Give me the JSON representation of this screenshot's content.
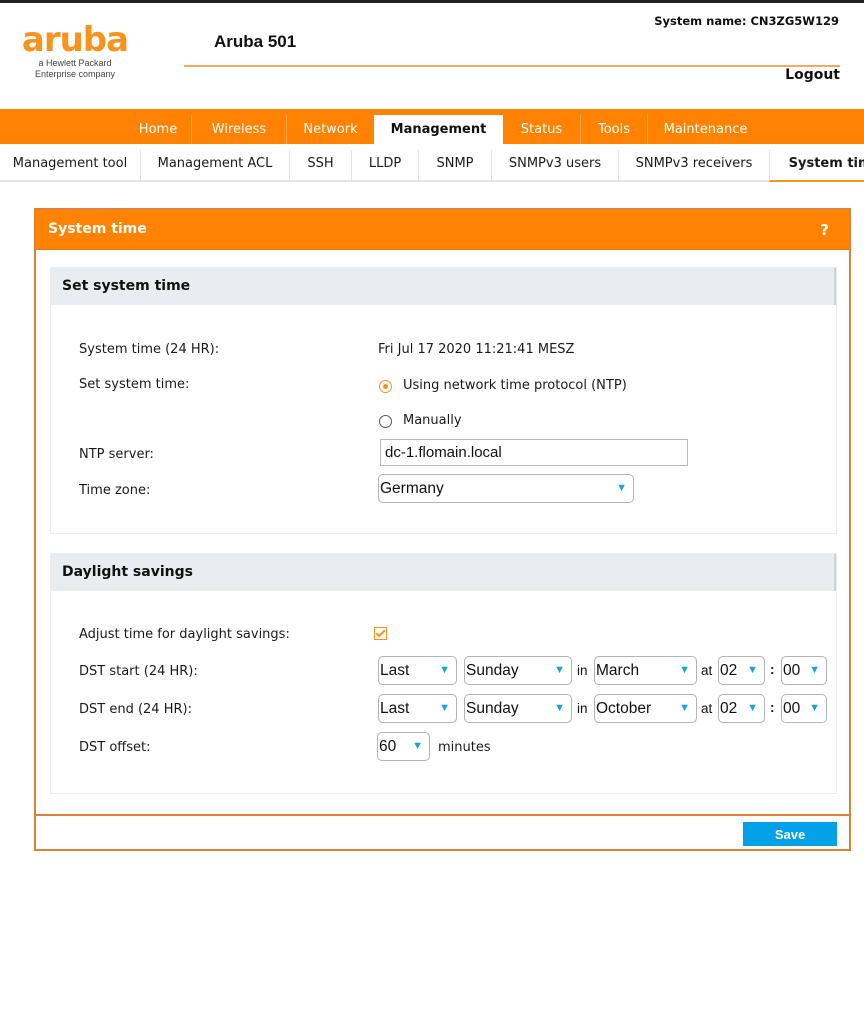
{
  "header": {
    "logo_word": "aruba",
    "logo_sub_1": "a Hewlett Packard",
    "logo_sub_2": "Enterprise company",
    "product_name": "Aruba 501",
    "system_name": "System name: CN3ZG5W129",
    "logout_label": "Logout"
  },
  "main_nav": {
    "tabs": [
      {
        "label": "Home"
      },
      {
        "label": "Wireless"
      },
      {
        "label": "Network"
      },
      {
        "label": "Management",
        "active": true
      },
      {
        "label": "Status"
      },
      {
        "label": "Tools"
      },
      {
        "label": "Maintenance"
      }
    ]
  },
  "sub_nav": {
    "tabs": [
      {
        "label": "Management tool"
      },
      {
        "label": "Management ACL"
      },
      {
        "label": "SSH"
      },
      {
        "label": "LLDP"
      },
      {
        "label": "SNMP"
      },
      {
        "label": "SNMPv3 users"
      },
      {
        "label": "SNMPv3 receivers"
      },
      {
        "label": "System time",
        "active": true
      }
    ]
  },
  "panel": {
    "title": "System time",
    "help_icon": "?",
    "set_system_time": {
      "title": "Set system time",
      "system_time_label": "System time (24 HR):",
      "system_time_value": "Fri Jul 17 2020 11:21:41 MESZ",
      "set_label": "Set system time:",
      "options": [
        {
          "label": "Using network time protocol (NTP)",
          "checked": true
        },
        {
          "label": "Manually",
          "checked": false
        }
      ],
      "ntp_label": "NTP server:",
      "ntp_value": "dc-1.flomain.local",
      "timezone_label": "Time zone:",
      "timezone_value": "Germany"
    },
    "daylight_savings": {
      "title": "Daylight savings",
      "adjust_label": "Adjust time for daylight savings:",
      "adjust_checked": true,
      "start_label": "DST start (24 HR):",
      "start": {
        "week": "Last",
        "day": "Sunday",
        "month": "March",
        "hour": "02",
        "minute": "00"
      },
      "end_label": "DST end (24 HR):",
      "end": {
        "week": "Last",
        "day": "Sunday",
        "month": "October",
        "hour": "02",
        "minute": "00"
      },
      "offset_label": "DST offset:",
      "offset_value": "60",
      "offset_unit": "minutes",
      "in_word": "in",
      "at_word": "at",
      "colon": ":"
    },
    "save_label": "Save"
  },
  "icons": {
    "caret": "▼"
  },
  "colors": {
    "brand_orange": "#ff8300",
    "accent_blue": "#04a1e8"
  }
}
